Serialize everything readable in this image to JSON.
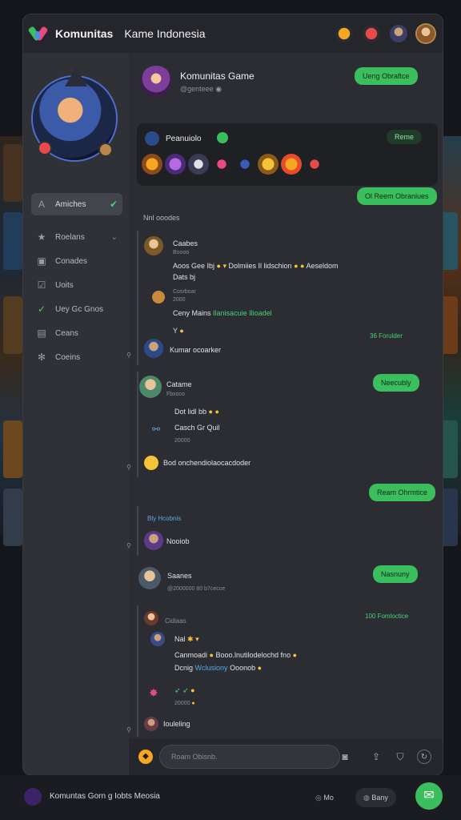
{
  "window": {
    "app_name": "Komunitas",
    "app_subtitle": "Kame Indonesia"
  },
  "sidebar": {
    "items": [
      {
        "label": "Amiches",
        "icon": "a-icon",
        "active": true
      },
      {
        "label": "Roelans",
        "icon": "star-icon"
      },
      {
        "label": "Conades",
        "icon": "chat-icon"
      },
      {
        "label": "Uoits",
        "icon": "check-square-icon"
      },
      {
        "label": "Uey Gc Gnos",
        "icon": "check-icon"
      },
      {
        "label": "Ceans",
        "icon": "doc-icon"
      },
      {
        "label": "Coeins",
        "icon": "settings-icon"
      }
    ]
  },
  "header": {
    "title": "Komunitas Game",
    "subtitle": "@genteee",
    "join_button": "Ueng Obraftce"
  },
  "featured": {
    "title": "Peanuiolo",
    "chip": "Reme",
    "action_button": "Ol Reem Obraniues"
  },
  "section_label": "Nnl ooodes",
  "posts": [
    {
      "author": "Caabes",
      "meta": "Boooo",
      "text1": "Aoos Gee Ibj",
      "text1b": "Dolmiies Il lidschion",
      "text1c": "Aeseldom",
      "text2": "Dats bj",
      "reply_author": "Cosrboar",
      "reply_meta": "2000",
      "reply_text": "Ceny Mains",
      "reply_link": "Ilanisacuie Ilioadel",
      "footer_left": "Y",
      "footer_right": "36 Forulder",
      "commenter": "Kumar ocoarker"
    },
    {
      "author": "Catame",
      "meta": "Fbxoco",
      "pill": "Neecubly",
      "text1": "Dot lidl bb",
      "text2": "Casch Gr Quil",
      "text2_meta": "20000",
      "footer": "Bod onchendiolaocacdoder"
    },
    {
      "pill_above": "Ream Ohrmtice",
      "title_link": "Bly Hcobnis",
      "commenter": "Nooiob"
    },
    {
      "author": "Saanes",
      "meta": "@2000000 80 b7cecce",
      "pill": "Nasnuny"
    },
    {
      "author": "Cidiaas",
      "meta_right": "100 Fomloctice",
      "line1": "Nal",
      "line2": "Canmoadi",
      "line2b": "Booo.lnutilodelochd fno",
      "line3": "Dcnig",
      "line3b": "Wclusiony",
      "line3c": "Ooonob",
      "line4_meta": "20000",
      "commenter": "Iouleling"
    }
  ],
  "input": {
    "placeholder": "Roam Obisnb."
  },
  "bottombar": {
    "title": "Komuntas Gorn g Iobts Meosia",
    "chip1": "Mo",
    "chip2": "Bany"
  },
  "colors": {
    "accent": "#3bbf5e",
    "link_blue": "#58a8e8",
    "background": "#2c2d33"
  }
}
